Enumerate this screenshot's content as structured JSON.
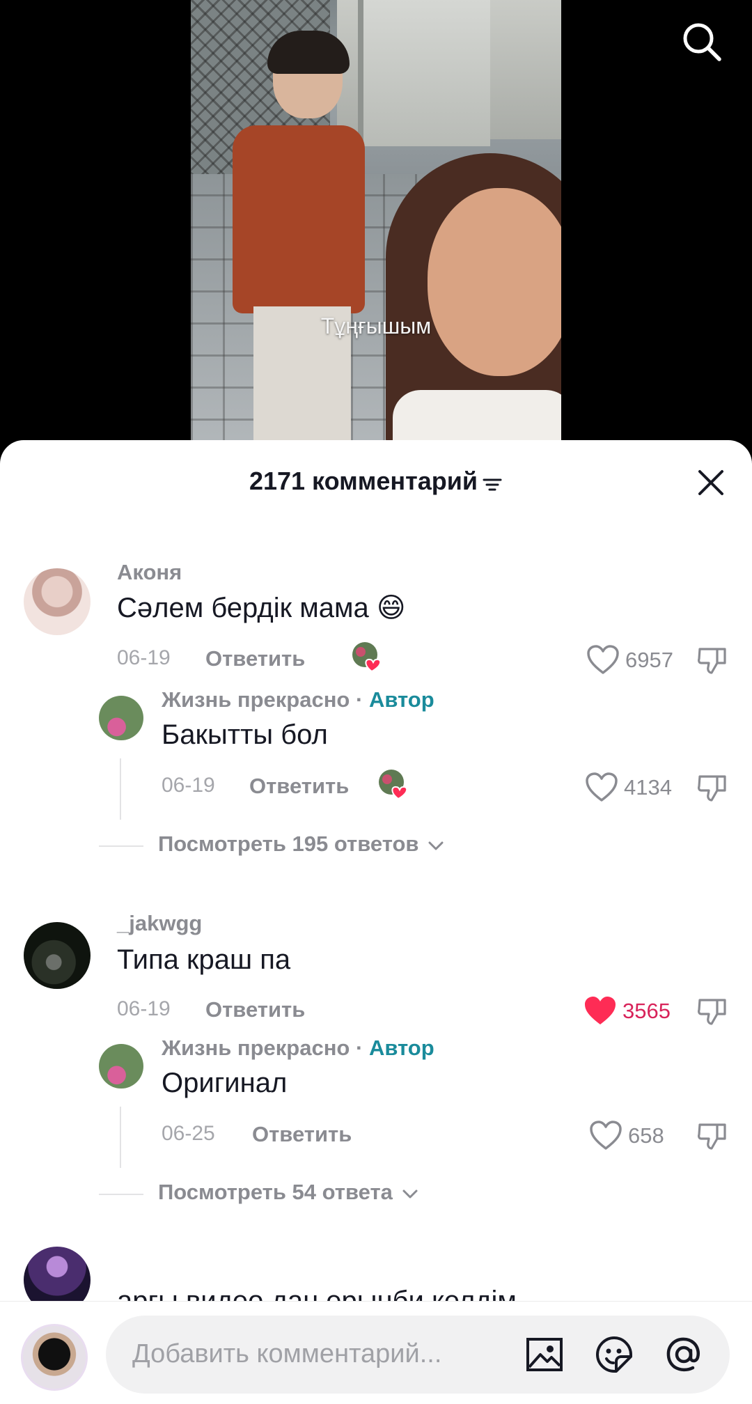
{
  "video": {
    "caption": "Тұңғышым"
  },
  "comments_header": {
    "title": "2171 комментарий"
  },
  "comments": [
    {
      "username": "Аконя",
      "text": "Сәлем бердік мама 😄",
      "date": "06-19",
      "reply_label": "Ответить",
      "likes": "6957"
    },
    {
      "username": "Жизнь прекрасно",
      "separator": "·",
      "author_badge": "Автор",
      "text": "Бакытты бол",
      "date": "06-19",
      "reply_label": "Ответить",
      "likes": "4134"
    },
    {
      "view_more": "Посмотреть 195 ответов"
    },
    {
      "username": "_jakwgg",
      "text": "Типа краш па",
      "date": "06-19",
      "reply_label": "Ответить",
      "likes": "3565"
    },
    {
      "username": "Жизнь прекрасно",
      "separator": "·",
      "author_badge": "Автор",
      "text": "Оригинал",
      "date": "06-25",
      "reply_label": "Ответить",
      "likes": "658"
    },
    {
      "view_more": "Посмотреть 54 ответа"
    },
    {
      "text": "арғы видео дан ерынби келдім"
    }
  ],
  "input": {
    "placeholder": "Добавить комментарий..."
  },
  "colors": {
    "accent_author": "#1a8b9b",
    "liked_heart": "#fe2c55"
  }
}
